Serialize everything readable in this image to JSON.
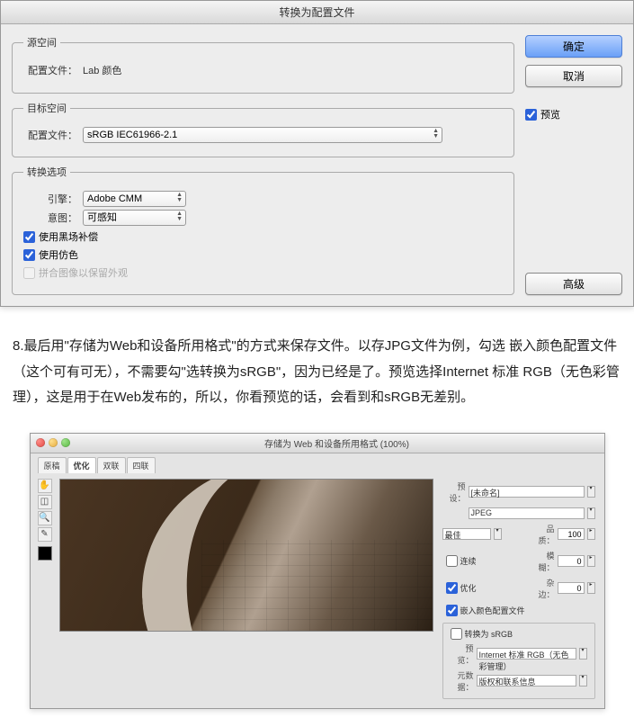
{
  "dialog1": {
    "title": "转换为配置文件",
    "fieldsets": {
      "source": {
        "legend": "源空间",
        "profile_label": "配置文件：",
        "profile_value": "Lab 颜色"
      },
      "dest": {
        "legend": "目标空间",
        "profile_label": "配置文件：",
        "profile_value": "sRGB IEC61966-2.1"
      },
      "options": {
        "legend": "转换选项",
        "engine_label": "引擎：",
        "engine_value": "Adobe CMM",
        "intent_label": "意图：",
        "intent_value": "可感知",
        "blackpoint_label": "使用黑场补偿",
        "blackpoint_checked": true,
        "dither_label": "使用仿色",
        "dither_checked": true,
        "flatten_label": "拼合图像以保留外观",
        "flatten_checked": false
      }
    },
    "buttons": {
      "ok": "确定",
      "cancel": "取消",
      "advanced": "高级"
    },
    "preview_label": "预览",
    "preview_checked": true
  },
  "article": {
    "text": "8.最后用\"存储为Web和设备所用格式\"的方式来保存文件。以存JPG文件为例，勾选 嵌入颜色配置文件（这个可有可无），不需要勾\"选转换为sRGB\"，因为已经是了。预览选择Internet 标准 RGB（无色彩管理），这是用于在Web发布的，所以，你看预览的话，会看到和sRGB无差别。"
  },
  "dialog2": {
    "title": "存储为 Web 和设备所用格式 (100%)",
    "tabs": [
      "原稿",
      "优化",
      "双联",
      "四联"
    ],
    "active_tab": 1,
    "sidepanel": {
      "preset_label": "预设：",
      "preset_value": "[未命名]",
      "format_value": "JPEG",
      "quality_mode": "最佳",
      "quality_label": "品质：",
      "quality_value": "100",
      "progressive_label": "连续",
      "progressive_checked": false,
      "blur_label": "模糊：",
      "blur_value": "0",
      "optimized_label": "优化",
      "optimized_checked": true,
      "matte_label": "杂边：",
      "matte_value": "0",
      "embed_label": "嵌入颜色配置文件",
      "embed_checked": true,
      "convert_srgb_label": "转换为 sRGB",
      "convert_srgb_checked": false,
      "preview_label": "预览：",
      "preview_value": "Internet 标准 RGB（无色彩管理）",
      "metadata_label": "元数据：",
      "metadata_value": "版权和联系信息"
    }
  }
}
